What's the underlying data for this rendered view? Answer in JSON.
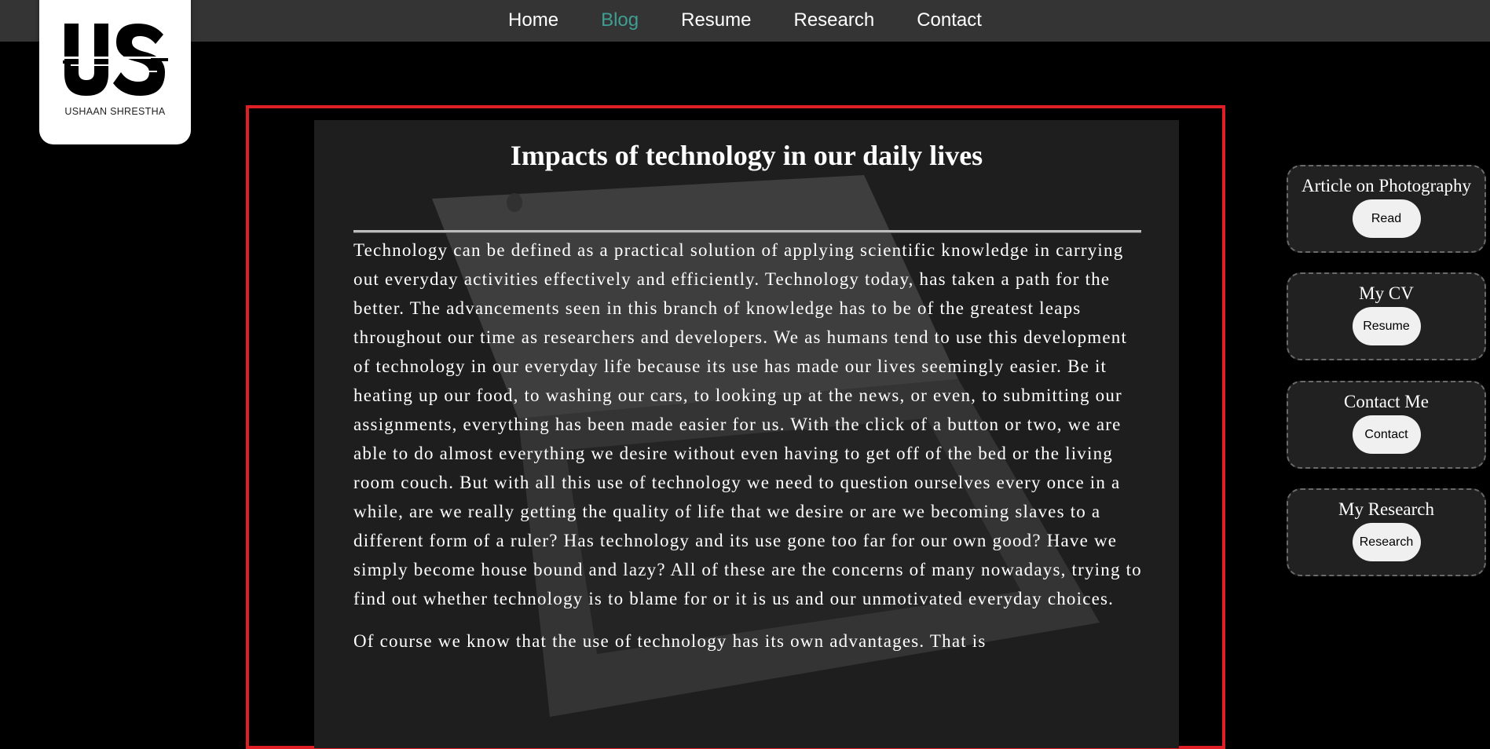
{
  "nav": {
    "items": [
      {
        "label": "Home",
        "active": false
      },
      {
        "label": "Blog",
        "active": true
      },
      {
        "label": "Resume",
        "active": false
      },
      {
        "label": "Research",
        "active": false
      },
      {
        "label": "Contact",
        "active": false
      }
    ],
    "active_color": "#3f9e94"
  },
  "logo": {
    "monogram": "US",
    "name": "USHAAN SHRESTHA"
  },
  "article": {
    "title": "Impacts of technology in our daily lives",
    "paragraphs": [
      "Technology can be defined as a practical solution of applying scientific knowledge in carrying out everyday activities effectively and efficiently. Technology today, has taken a path for the better. The advancements seen in this branch of knowledge has to be of the greatest leaps throughout our time as researchers and developers. We as humans tend to use this development of technology in our everyday life because its use has made our lives seemingly easier. Be it heating up our food, to washing our cars, to looking up at the news, or even, to submitting our assignments, everything has been made easier for us. With the click of a button or two, we are able to do almost everything we desire without even having to get off of the bed or the living room couch. But with all this use of technology we need to question ourselves every once in a while, are we really getting the quality of life that we desire or are we becoming slaves to a different form of a ruler? Has technology and its use gone too far for our own good? Have we simply become house bound and lazy? All of these are the concerns of many nowadays, trying to find out whether technology is to blame for or it is us and our unmotivated everyday choices.",
      "Of course we know that the use of technology has its own advantages. That is"
    ]
  },
  "sidebar": {
    "cards": [
      {
        "title": "Article on Photography",
        "button": "Read"
      },
      {
        "title": "My CV",
        "button": "Resume"
      },
      {
        "title": "Contact Me",
        "button": "Contact"
      },
      {
        "title": "My Research",
        "button": "Research"
      }
    ]
  },
  "colors": {
    "navbar_bg": "#333433",
    "page_bg": "#000000",
    "highlight_frame": "#e01e26",
    "card_bg": "#1e1e1e"
  }
}
